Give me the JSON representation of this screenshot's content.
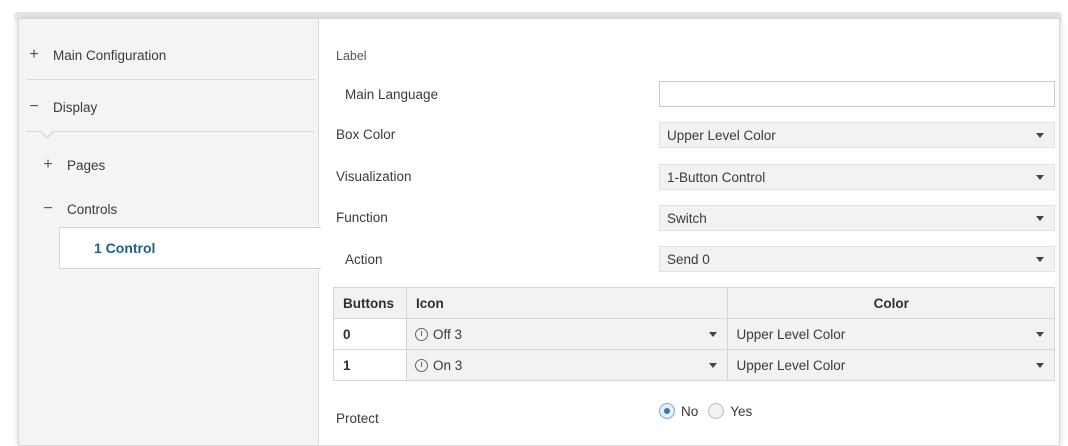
{
  "sidebar": {
    "items": [
      {
        "sign": "+",
        "label": "Main Configuration"
      },
      {
        "sign": "−",
        "label": "Display"
      },
      {
        "sign": "+",
        "label": "Pages"
      },
      {
        "sign": "−",
        "label": "Controls"
      },
      {
        "sign": "",
        "label": "1 Control"
      }
    ]
  },
  "form": {
    "label_heading": "Label",
    "main_language": {
      "label": "Main Language",
      "value": ""
    },
    "box_color": {
      "label": "Box Color",
      "value": "Upper Level Color"
    },
    "visualization": {
      "label": "Visualization",
      "value": "1-Button Control"
    },
    "function": {
      "label": "Function",
      "value": "Switch"
    },
    "action": {
      "label": "Action",
      "value": "Send 0"
    },
    "table": {
      "headers": [
        "Buttons",
        "Icon",
        "Color"
      ],
      "rows": [
        {
          "button": "0",
          "icon": "Off 3",
          "color": "Upper Level Color"
        },
        {
          "button": "1",
          "icon": "On 3",
          "color": "Upper Level Color"
        }
      ]
    },
    "protect": {
      "label": "Protect",
      "options": [
        "No",
        "Yes"
      ],
      "selected": "No"
    }
  },
  "colors": {
    "accent": "#1f5f8b",
    "radio_selected": "#3c76b0"
  }
}
